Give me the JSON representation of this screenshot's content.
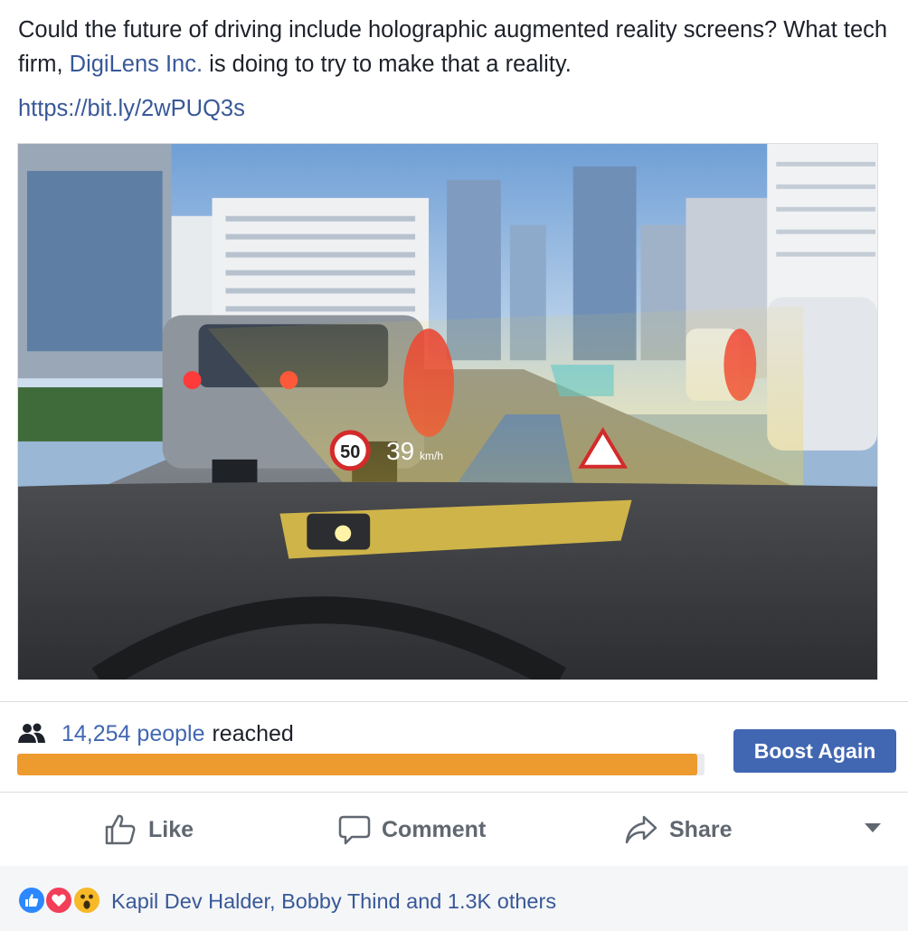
{
  "post": {
    "text_before": "Could the future of driving include holographic augmented reality screens? What tech firm, ",
    "mention": "DigiLens Inc.",
    "text_after": " is doing to try to make that a reality.",
    "link": "https://bit.ly/2wPUQ3s",
    "image": {
      "speed_limit": "50",
      "speed": "39",
      "speed_unit": "km/h"
    }
  },
  "insights": {
    "reach_count": "14,254 people",
    "reach_suffix": "reached",
    "reach_progress_fraction": 0.99,
    "boost_label": "Boost Again",
    "icon": "people-icon"
  },
  "actions": {
    "like_label": "Like",
    "comment_label": "Comment",
    "share_label": "Share"
  },
  "reactions": {
    "icons": [
      "like-icon",
      "love-icon",
      "wow-icon"
    ],
    "summary": "Kapil Dev Halder, Bobby Thind and 1.3K others"
  },
  "colors": {
    "link": "#385898",
    "boost": "#4267b2",
    "progress": "#ed9a2f",
    "action_text": "#606770"
  }
}
